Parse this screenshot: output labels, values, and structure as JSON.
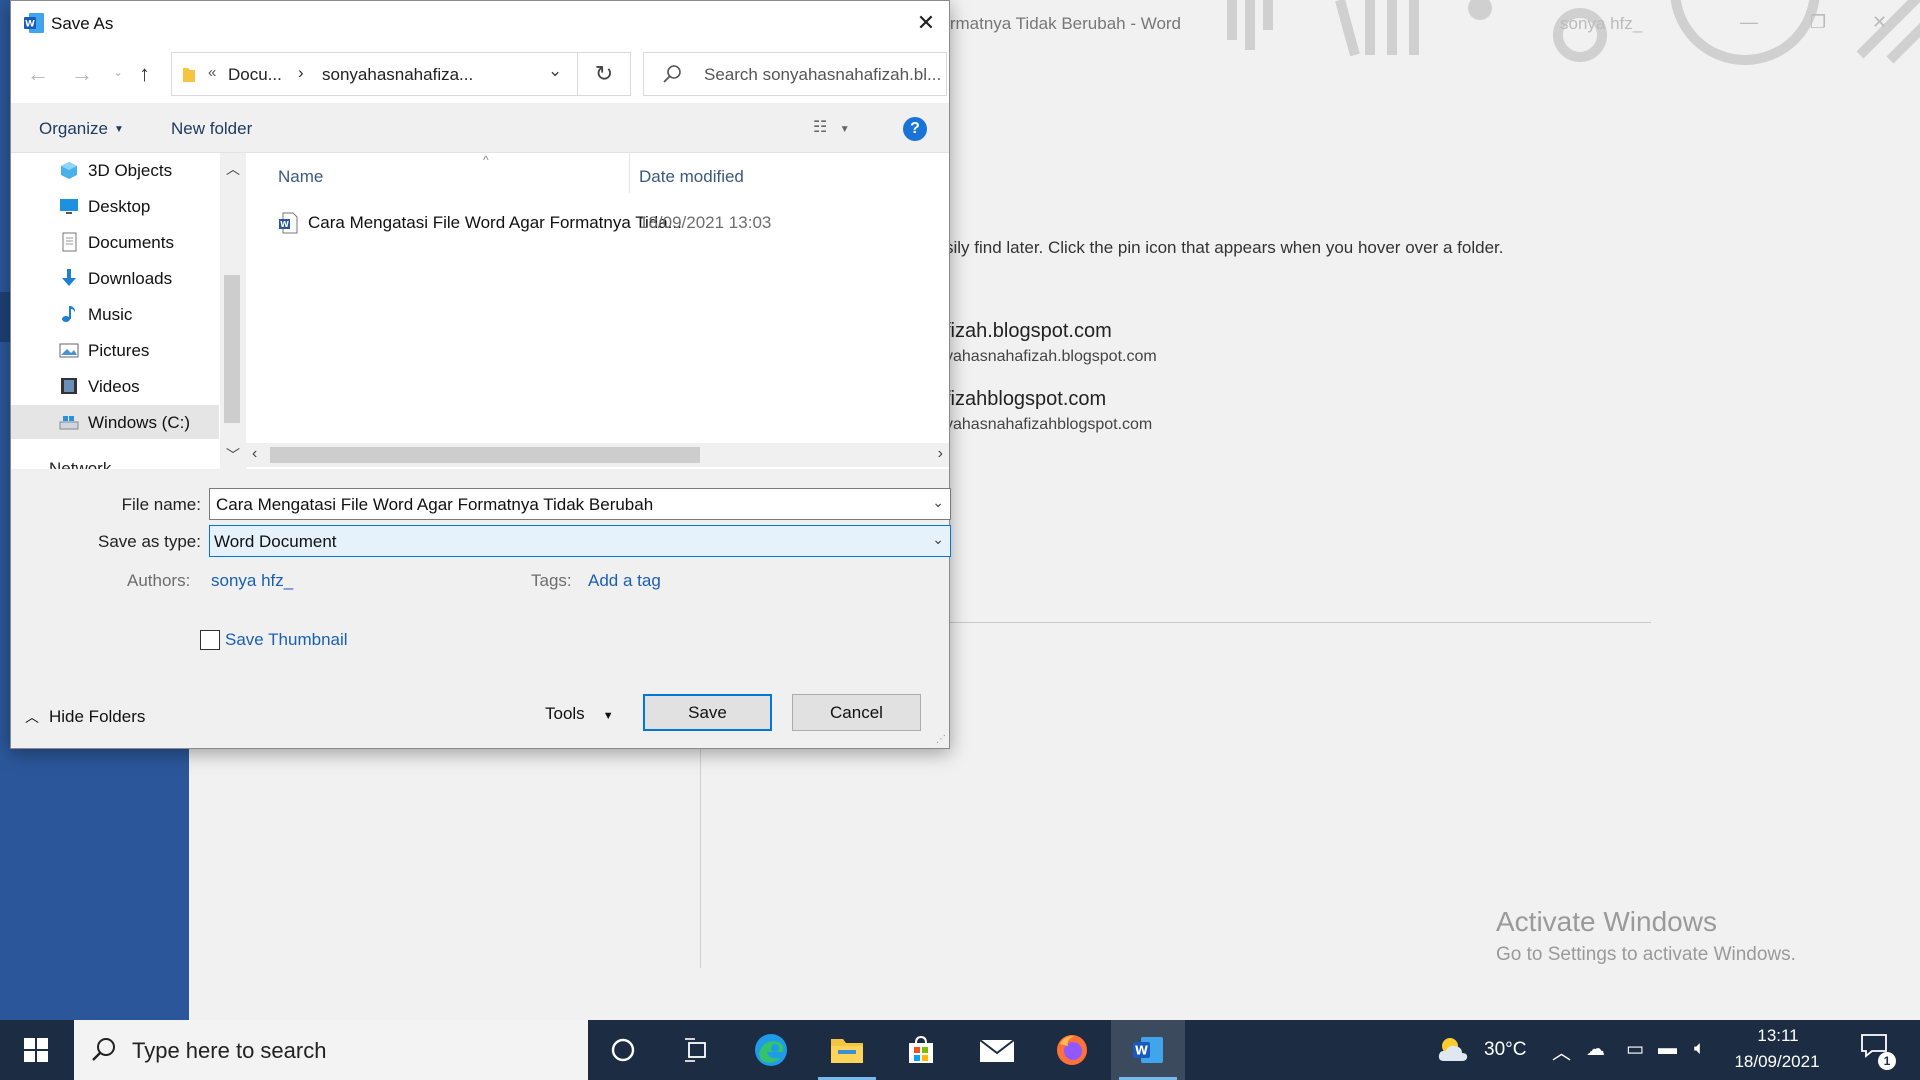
{
  "background": {
    "window_title": "Formatnya Tidak Berubah  -  Word",
    "user": "sonya hfz_",
    "pin_hint": "sily find later. Click the pin icon that appears when you hover over a folder.",
    "locations": [
      {
        "title": "fizah.blogspot.com",
        "subtitle": "yahasnahafizah.blogspot.com"
      },
      {
        "title": "fizahblogspot.com",
        "subtitle": "yahasnahafizahblogspot.com"
      }
    ],
    "activate_title": "Activate Windows",
    "activate_sub": "Go to Settings to activate Windows.",
    "accent_color": "#2b579a"
  },
  "dialog": {
    "title": "Save As",
    "address": {
      "overflow_chevron": "«",
      "segment1": "Docu...",
      "separator": "›",
      "segment2": "sonyahasnahafiza..."
    },
    "search_placeholder": "Search sonyahasnahafizah.bl...",
    "toolbar": {
      "organize": "Organize",
      "new_folder": "New folder",
      "help": "?"
    },
    "tree": [
      {
        "label": "3D Objects",
        "icon": "cube-icon"
      },
      {
        "label": "Desktop",
        "icon": "desktop-icon"
      },
      {
        "label": "Documents",
        "icon": "documents-icon"
      },
      {
        "label": "Downloads",
        "icon": "download-arrow-icon"
      },
      {
        "label": "Music",
        "icon": "music-note-icon"
      },
      {
        "label": "Pictures",
        "icon": "pictures-icon"
      },
      {
        "label": "Videos",
        "icon": "film-icon"
      },
      {
        "label": "Windows (C:)",
        "icon": "drive-icon",
        "selected": true
      }
    ],
    "tree_partial": "Network",
    "columns": {
      "name": "Name",
      "date": "Date modified"
    },
    "files": [
      {
        "name": "Cara Mengatasi File Word Agar Formatnya Tida...",
        "date": "18/09/2021 13:03",
        "icon": "word-doc-icon"
      }
    ],
    "form": {
      "file_name_label": "File name:",
      "file_name_value": "Cara Mengatasi File Word Agar Formatnya Tidak Berubah",
      "save_type_label": "Save as type:",
      "save_type_value": "Word Document",
      "authors_label": "Authors:",
      "authors_value": "sonya hfz_",
      "tags_label": "Tags:",
      "tags_value": "Add a tag",
      "thumbnail_label": "Save Thumbnail",
      "thumbnail_checked": false
    },
    "buttons": {
      "hide_folders": "Hide Folders",
      "tools": "Tools",
      "save": "Save",
      "cancel": "Cancel"
    }
  },
  "taskbar": {
    "search_placeholder": "Type here to search",
    "apps": [
      "cortana-icon",
      "task-view-icon",
      "edge-icon",
      "file-explorer-icon",
      "store-icon",
      "mail-icon",
      "firefox-icon",
      "word-icon"
    ],
    "temperature": "30°C",
    "time": "13:11",
    "date": "18/09/2021",
    "notifications": "1"
  }
}
